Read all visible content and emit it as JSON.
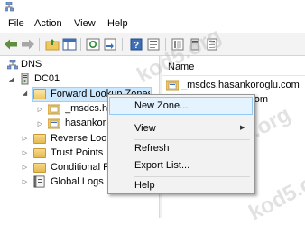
{
  "menu": {
    "items": [
      "File",
      "Action",
      "View",
      "Help"
    ]
  },
  "tree": {
    "root": "DNS",
    "server": "DC01",
    "nodes": {
      "forward_zones": "Forward Lookup Zones",
      "msdcs_zone": "_msdcs.ha",
      "main_zone": "hasankor",
      "reverse_zones": "Reverse Look",
      "trust_points": "Trust Points",
      "conditional": "Conditional F",
      "global_logs": "Global Logs"
    }
  },
  "list": {
    "header": "Name",
    "items": [
      "_msdcs.hasankoroglu.com",
      "_hasankoroglu.com"
    ]
  },
  "context_menu": {
    "new_zone": "New Zone...",
    "view": "View",
    "refresh": "Refresh",
    "export": "Export List...",
    "help": "Help",
    "submenu_arrow": "▶"
  },
  "watermark": "kod5.org",
  "colors": {
    "selection": "#cce8ff",
    "menu_hover": "#e5f3ff",
    "folder": "#e7b94e"
  }
}
